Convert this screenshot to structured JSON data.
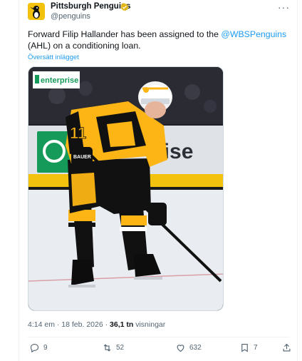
{
  "account": {
    "display_name": "Pittsburgh Penguins",
    "handle": "@penguins",
    "verified_icon": "gold-verified-badge-icon",
    "more_icon": "more-options-icon"
  },
  "tweet": {
    "text_before": "Forward Filip Hallander has been assigned to the ",
    "mention": "@WBSPenguins",
    "text_after": " (AHL) on a conditioning loan.",
    "translate_label": "Översätt inlägget"
  },
  "media": {
    "sponsor_logo_text": "enterprise",
    "board_text": "rise",
    "jersey_number": "11",
    "glove_brand": "BAUER",
    "colors": {
      "gold": "#fcb514",
      "black": "#111111",
      "rink": "#e8eaee",
      "enterprise_green": "#169a5a"
    }
  },
  "meta": {
    "time": "4:14 em",
    "date": "18 feb. 2026",
    "separator": "·",
    "views_count": "36,1 tn",
    "views_label": "visningar"
  },
  "actions": {
    "replies": "9",
    "reposts": "52",
    "likes": "632",
    "bookmarks": "7"
  },
  "colors": {
    "link": "#1d9bf0",
    "secondary_text": "#536471",
    "verified": "#e2b719"
  }
}
